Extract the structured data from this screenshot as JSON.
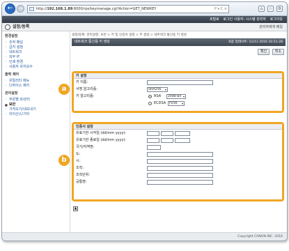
{
  "browser": {
    "url_prefix": "http://",
    "url_host": "192.168.1.89",
    "url_path": ":8000/rps/keymanage.cgi?Action=GET_NEWKEY",
    "url_tail": "P ▾ C ×"
  },
  "topbar": {
    "portal": "포털로",
    "login_user": "로그인 사용자: 시스템 관리자",
    "logout": "로그아웃"
  },
  "header": {
    "title": "설정/등록",
    "right_link": "관리자에게 메일"
  },
  "sidebar": {
    "sections": [
      {
        "head": "환경설정",
        "items": [
          "조작 패널",
          "급지 설정",
          "네트워크",
          "외부 IF",
          "인쇄 환경",
          "사용자 유지보수"
        ]
      },
      {
        "head": "출력 제어",
        "items": [
          "유틸리티 메뉴",
          "디바이스 제어"
        ]
      },
      {
        "head": "관리설정",
        "items": [
          "부문별 ID관리",
          "보안",
          "가져오기/내보내기",
          "라이선스/기타"
        ]
      }
    ],
    "active_item": "보안"
  },
  "main": {
    "breadcrumb": "설정/등록: 관리설정: 보안 > 키 및 인증서 설정 > 키 생성 > 네트워크 통신용 키 생성",
    "page_title": "네트워크 통신용 키 생성",
    "last_update": "최종 업데이트: 11/11 2016 10:21:28",
    "ok_label": "확인",
    "cancel_label": "취소"
  },
  "key_settings": {
    "heading": "키 설정",
    "key_name_label": "키 이름:",
    "key_name_value": "",
    "sig_algo_label": "서명 알고리즘:",
    "sig_algo_value": "SHA256",
    "key_algo_label": "키 알고리즘:",
    "rsa_label": "RSA",
    "rsa_value": "2048-bit",
    "ecdsa_label": "ECDSA",
    "ecdsa_value": "P256",
    "selected_algo": "RSA"
  },
  "cert_settings": {
    "heading": "인증서 설정",
    "valid_start_label": "유효기한 시작일 (dd/mm yyyy):",
    "valid_end_label": "유효기한 종료일 (dd/mm yyyy):",
    "country_label": "국가/지역명:",
    "state_label": "도:",
    "city_label": "시:",
    "org_label": "조직:",
    "org_unit_label": "조직단위:",
    "common_name_label": "공통명:"
  },
  "callouts": {
    "a": "a",
    "b": "b"
  },
  "footer": {
    "copyright": "Copyright CANON INC. 2016"
  },
  "colors": {
    "accent": "#f0a623",
    "header": "#3f4852",
    "link": "#225a9c"
  },
  "icons": [
    "back-arrow-icon",
    "forward-arrow-icon",
    "page-icon",
    "home-icon",
    "star-icon",
    "settings-icon",
    "printer-logo-icon",
    "back-to-top-icon"
  ]
}
